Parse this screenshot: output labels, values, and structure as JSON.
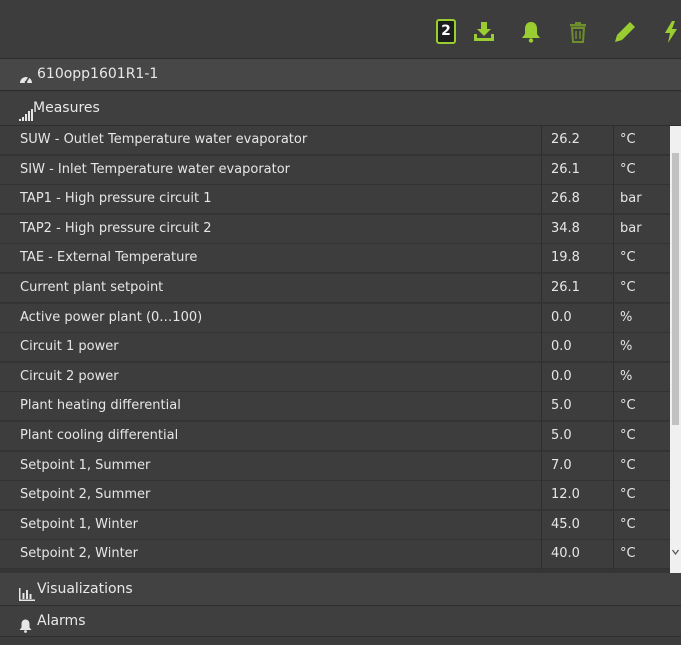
{
  "toolbar": {
    "badge_count": "2",
    "icons": [
      "download-icon",
      "bell-icon",
      "trash-icon",
      "pencil-icon",
      "bolt-icon"
    ],
    "accent_color": "#9acd32"
  },
  "device": {
    "name": "610opp1601R1-1",
    "icon": "dashboard-icon"
  },
  "sections": {
    "measures": "Measures",
    "visualizations": "Visualizations",
    "alarms": "Alarms"
  },
  "measures": [
    {
      "name": "SUW - Outlet Temperature water evaporator",
      "value": "26.2",
      "unit": "°C"
    },
    {
      "name": "SIW - Inlet Temperature water evaporator",
      "value": "26.1",
      "unit": "°C"
    },
    {
      "name": "TAP1 - High pressure circuit 1",
      "value": "26.8",
      "unit": "bar"
    },
    {
      "name": "TAP2 - High pressure circuit 2",
      "value": "34.8",
      "unit": "bar"
    },
    {
      "name": "TAE - External Temperature",
      "value": "19.8",
      "unit": "°C"
    },
    {
      "name": "Current plant setpoint",
      "value": "26.1",
      "unit": "°C"
    },
    {
      "name": "Active power plant (0…100)",
      "value": "0.0",
      "unit": "%"
    },
    {
      "name": "Circuit 1 power",
      "value": "0.0",
      "unit": "%"
    },
    {
      "name": "Circuit 2 power",
      "value": "0.0",
      "unit": "%"
    },
    {
      "name": "Plant heating differential",
      "value": "5.0",
      "unit": "°C"
    },
    {
      "name": "Plant cooling differential",
      "value": "5.0",
      "unit": "°C"
    },
    {
      "name": "Setpoint 1, Summer",
      "value": "7.0",
      "unit": "°C"
    },
    {
      "name": "Setpoint 2, Summer",
      "value": "12.0",
      "unit": "°C"
    },
    {
      "name": "Setpoint 1, Winter",
      "value": "45.0",
      "unit": "°C"
    },
    {
      "name": "Setpoint 2, Winter",
      "value": "40.0",
      "unit": "°C"
    }
  ]
}
